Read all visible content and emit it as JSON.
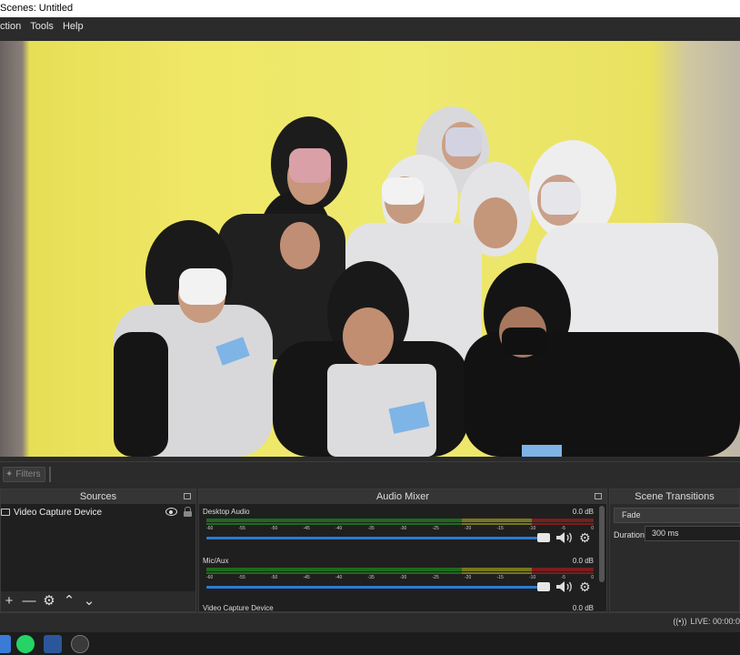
{
  "window": {
    "title": "Scenes: Untitled"
  },
  "menu": {
    "items": [
      "ction",
      "Tools",
      "Help"
    ]
  },
  "filter_bar": {
    "filters_label": "Filters"
  },
  "sources": {
    "title": "Sources",
    "items": [
      {
        "name": "Video Capture Device"
      }
    ]
  },
  "mixer": {
    "title": "Audio Mixer",
    "channels": [
      {
        "name": "Desktop Audio",
        "db": "0.0 dB"
      },
      {
        "name": "Mic/Aux",
        "db": "0.0 dB"
      },
      {
        "name": "Video Capture Device",
        "db": "0.0 dB"
      }
    ],
    "ticks": [
      "-60",
      "-55",
      "-50",
      "-45",
      "-40",
      "-35",
      "-30",
      "-25",
      "-20",
      "-15",
      "-10",
      "-5",
      "0"
    ]
  },
  "transitions": {
    "title": "Scene Transitions",
    "selected": "Fade",
    "duration_label": "Duration",
    "duration_value": "300 ms"
  },
  "status": {
    "live": "LIVE: 00:00:0"
  },
  "colors": {
    "accent": "#2b7bd6",
    "backdrop": "#ece660"
  }
}
